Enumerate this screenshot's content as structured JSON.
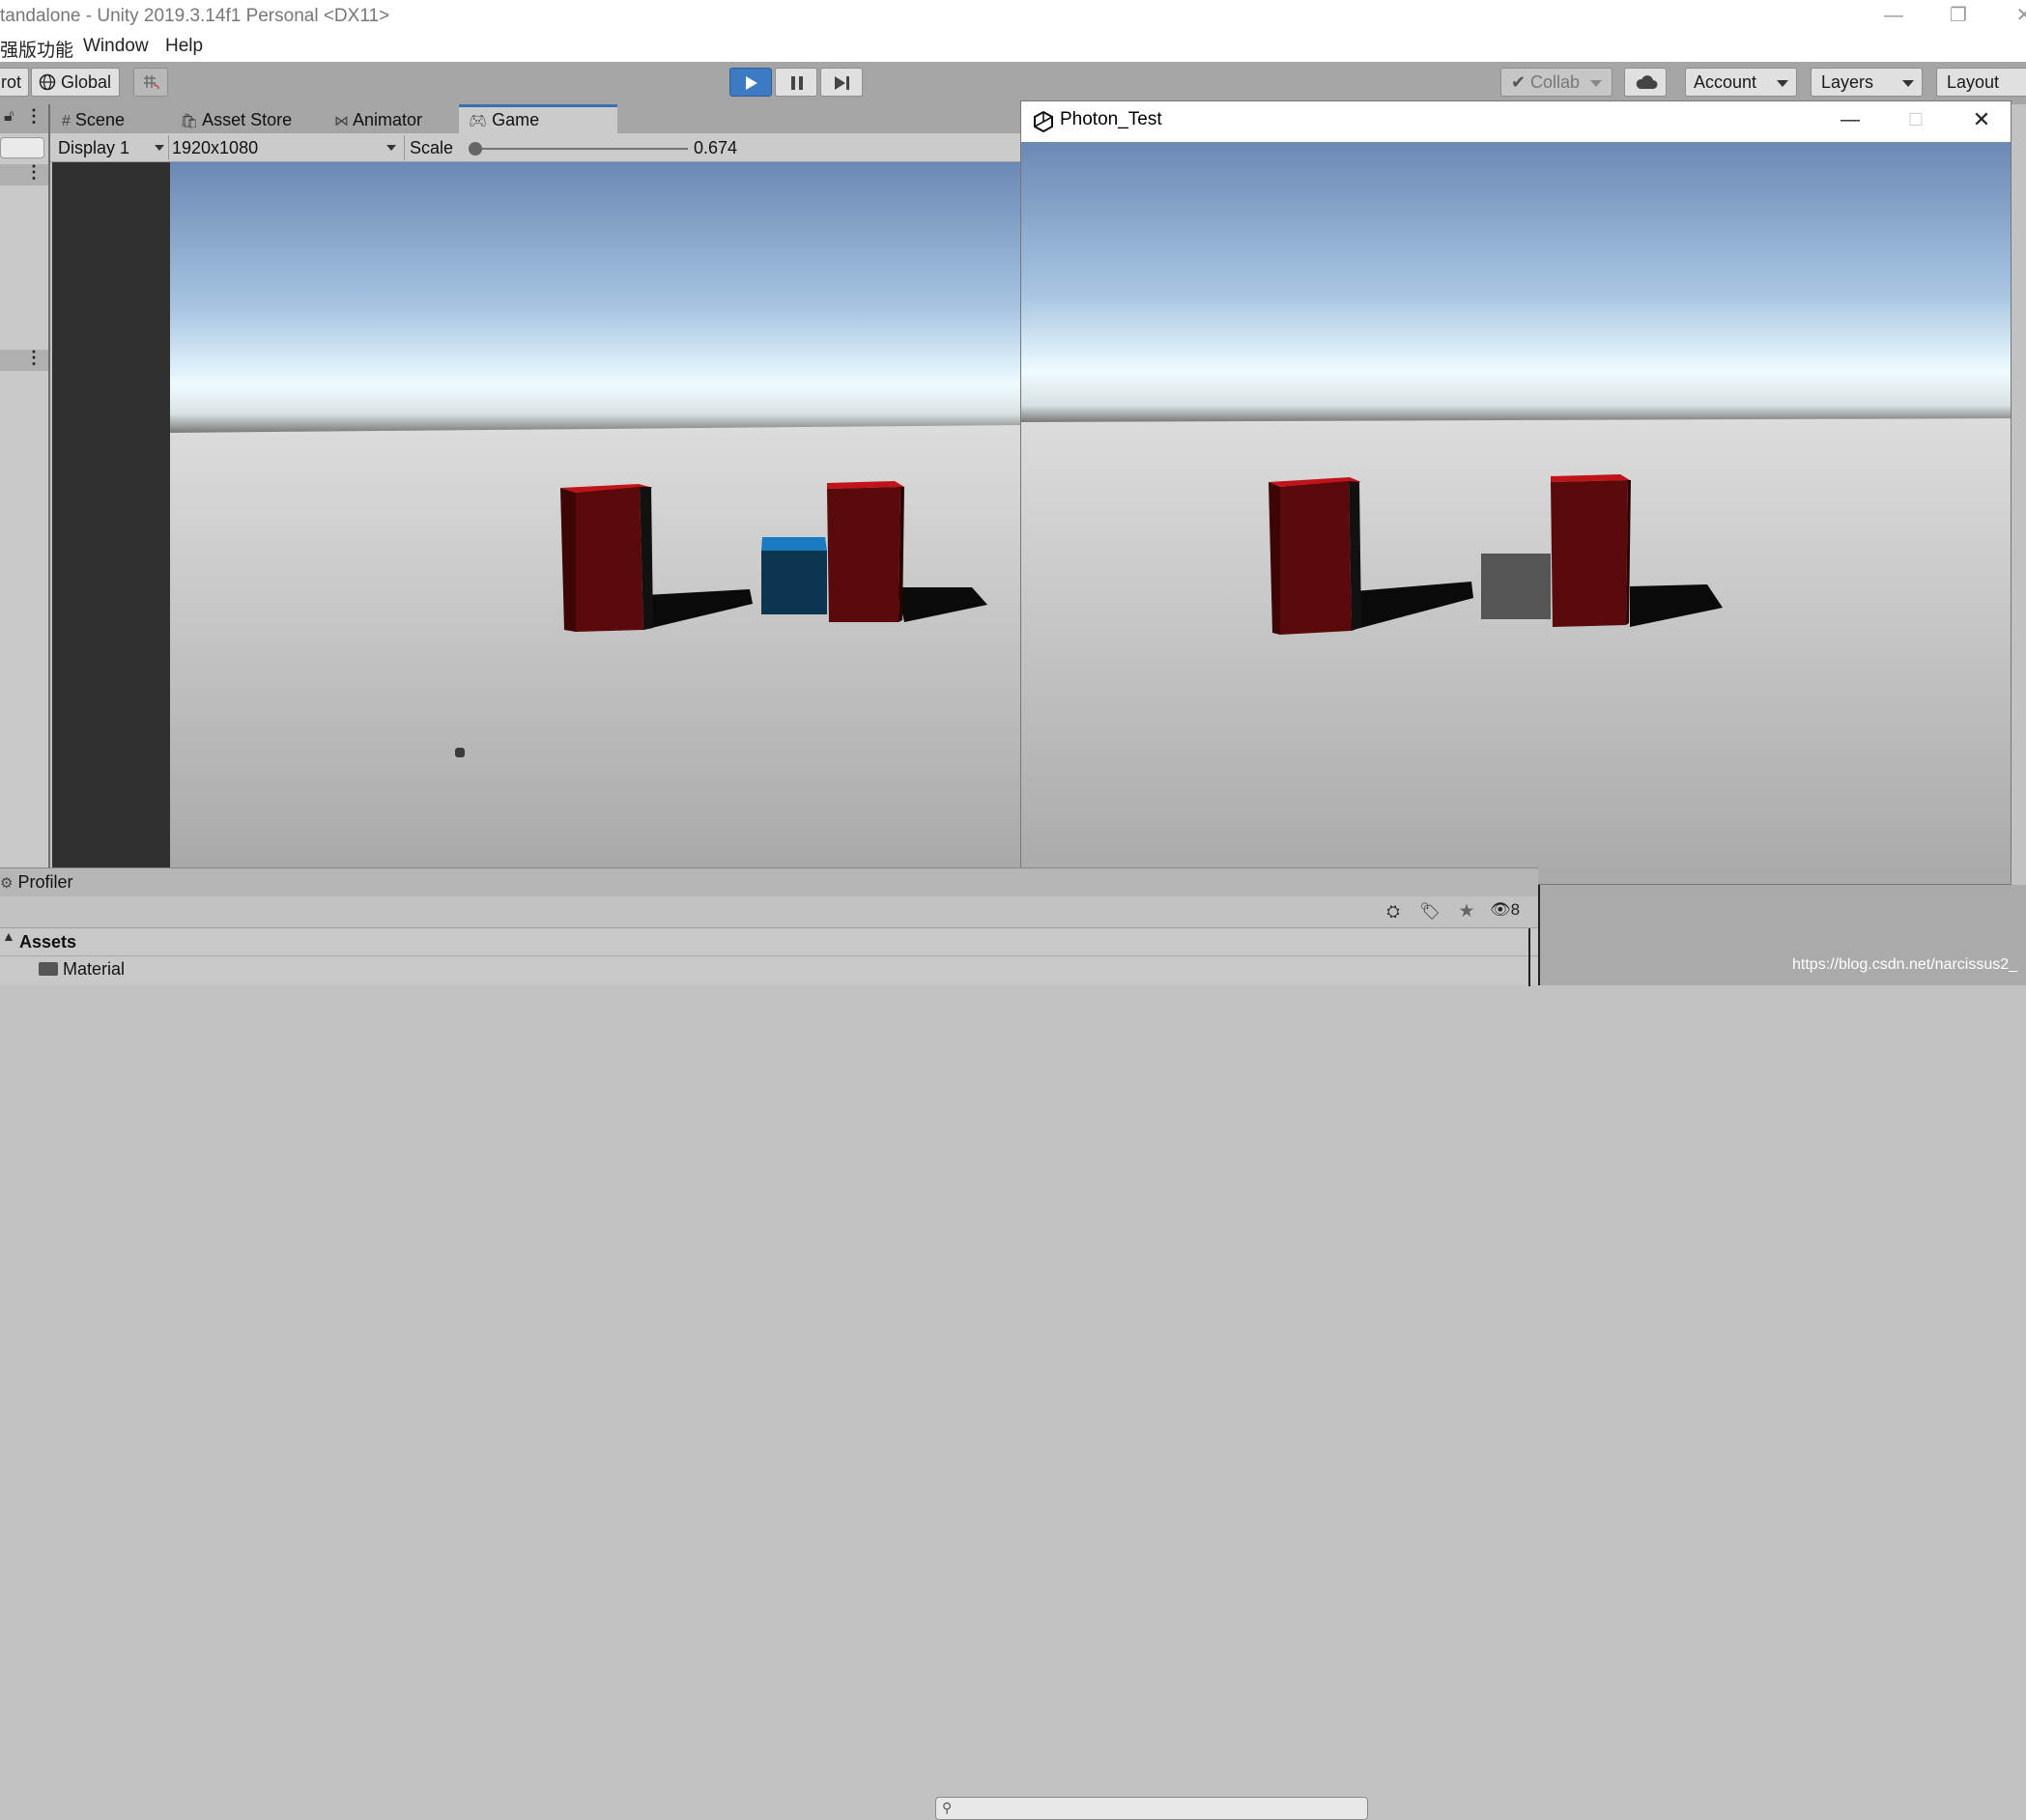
{
  "window": {
    "title": "tandalone - Unity 2019.3.14f1 Personal <DX11>"
  },
  "menu": {
    "items": [
      "强版功能",
      "Window",
      "Help"
    ]
  },
  "toolbar": {
    "pivot_label": "rot",
    "global_label": "Global",
    "collab_label": "Collab",
    "account_label": "Account",
    "layers_label": "Layers",
    "layout_label": "Layout"
  },
  "tabs": {
    "scene": "Scene",
    "asset_store": "Asset Store",
    "animator": "Animator",
    "game": "Game"
  },
  "game_toolbar": {
    "display": "Display 1",
    "resolution": "1920x1080",
    "scale_label": "Scale",
    "scale_value": "0.674"
  },
  "popup": {
    "title": "Photon_Test"
  },
  "bottom": {
    "profiler": "Profiler",
    "assets_header": "Assets",
    "folder": "Material",
    "hidden_count": "8"
  },
  "watermark": "https://blog.csdn.net/narcissus2_",
  "colors": {
    "accent": "#3a72b0",
    "red_box": "#5a0a0a",
    "blue_box": "#0c3550",
    "gray_box": "#555555"
  }
}
